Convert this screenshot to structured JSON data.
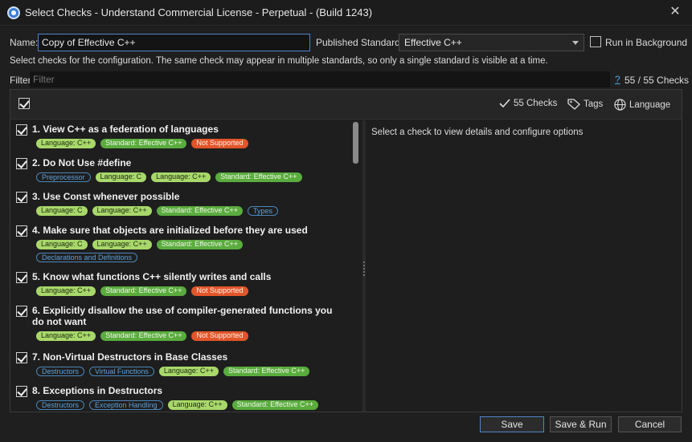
{
  "window": {
    "title": "Select Checks - Understand Commercial License - Perpetual - (Build 1243)"
  },
  "form": {
    "name_label": "Name:",
    "name_value": "Copy of Effective C++",
    "standard_label": "Published Standard:",
    "standard_value": "Effective C++",
    "run_background_label": "Run in Background",
    "hint": "Select checks for the configuration. The same check may appear in multiple standards, so only a single standard is visible at a time.",
    "filter_label": "Filter:",
    "filter_placeholder": "Filter",
    "help_link": "?",
    "count": "55 / 55 Checks"
  },
  "toolbar": {
    "checks": "55 Checks",
    "tags": "Tags",
    "language": "Language"
  },
  "details": {
    "placeholder": "Select a check to view details and configure options"
  },
  "checks": [
    {
      "title": "1. View C++ as a federation of languages",
      "tags": [
        {
          "text": "Language: C++",
          "kind": "lang"
        },
        {
          "text": "Standard: Effective C++",
          "kind": "std"
        },
        {
          "text": "Not Supported",
          "kind": "ns"
        }
      ]
    },
    {
      "title": "2. Do Not Use #define",
      "tags": [
        {
          "text": "Preprocessor",
          "kind": "out"
        },
        {
          "text": "Language: C",
          "kind": "lang"
        },
        {
          "text": "Language: C++",
          "kind": "lang"
        },
        {
          "text": "Standard: Effective C++",
          "kind": "std"
        }
      ]
    },
    {
      "title": "3. Use Const whenever possible",
      "tags": [
        {
          "text": "Language: C",
          "kind": "lang"
        },
        {
          "text": "Language: C++",
          "kind": "lang"
        },
        {
          "text": "Standard: Effective C++",
          "kind": "std"
        },
        {
          "text": "Types",
          "kind": "out"
        }
      ]
    },
    {
      "title": "4. Make sure that objects are initialized before they are used",
      "tags": [
        {
          "text": "Language: C",
          "kind": "lang"
        },
        {
          "text": "Language: C++",
          "kind": "lang"
        },
        {
          "text": "Standard: Effective C++",
          "kind": "std"
        },
        {
          "text": "Declarations and Definitions",
          "kind": "out"
        }
      ]
    },
    {
      "title": "5. Know what functions C++ silently writes and calls",
      "tags": [
        {
          "text": "Language: C++",
          "kind": "lang"
        },
        {
          "text": "Standard: Effective C++",
          "kind": "std"
        },
        {
          "text": "Not Supported",
          "kind": "ns"
        }
      ]
    },
    {
      "title": "6. Explicitly disallow the use of compiler-generated functions you do not want",
      "tags": [
        {
          "text": "Language: C++",
          "kind": "lang"
        },
        {
          "text": "Standard: Effective C++",
          "kind": "std"
        },
        {
          "text": "Not Supported",
          "kind": "ns"
        }
      ]
    },
    {
      "title": "7. Non-Virtual Destructors in Base Classes",
      "tags": [
        {
          "text": "Destructors",
          "kind": "out"
        },
        {
          "text": "Virtual Functions",
          "kind": "out"
        },
        {
          "text": "Language: C++",
          "kind": "lang"
        },
        {
          "text": "Standard: Effective C++",
          "kind": "std"
        }
      ]
    },
    {
      "title": "8. Exceptions in Destructors",
      "tags": [
        {
          "text": "Destructors",
          "kind": "out"
        },
        {
          "text": "Exception Handling",
          "kind": "out"
        },
        {
          "text": "Language: C++",
          "kind": "lang"
        },
        {
          "text": "Standard: Effective C++",
          "kind": "std"
        }
      ]
    }
  ],
  "buttons": {
    "save": "Save",
    "save_run": "Save & Run",
    "cancel": "Cancel"
  }
}
